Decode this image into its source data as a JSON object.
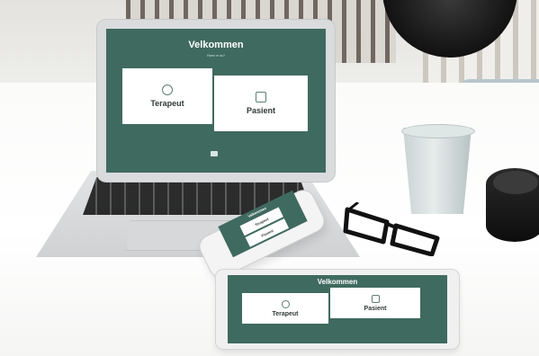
{
  "laptop_screen": {
    "title": "Velkommen",
    "subtitle": "Hvem er du?",
    "cards": [
      {
        "label": "Terapeut",
        "icon": "therapist-icon"
      },
      {
        "label": "Pasient",
        "icon": "patient-icon"
      }
    ]
  },
  "tablet_screen": {
    "title": "Velkommen",
    "cards": [
      {
        "label": "Terapeut",
        "icon": "therapist-icon"
      },
      {
        "label": "Pasient",
        "icon": "patient-icon"
      }
    ]
  },
  "phone_screen": {
    "title": "Velkommen",
    "cards": [
      {
        "label": "Terapeut"
      },
      {
        "label": "Pasient"
      }
    ]
  },
  "colors": {
    "brand_green": "#3f6a5f",
    "card_white": "#ffffff"
  }
}
